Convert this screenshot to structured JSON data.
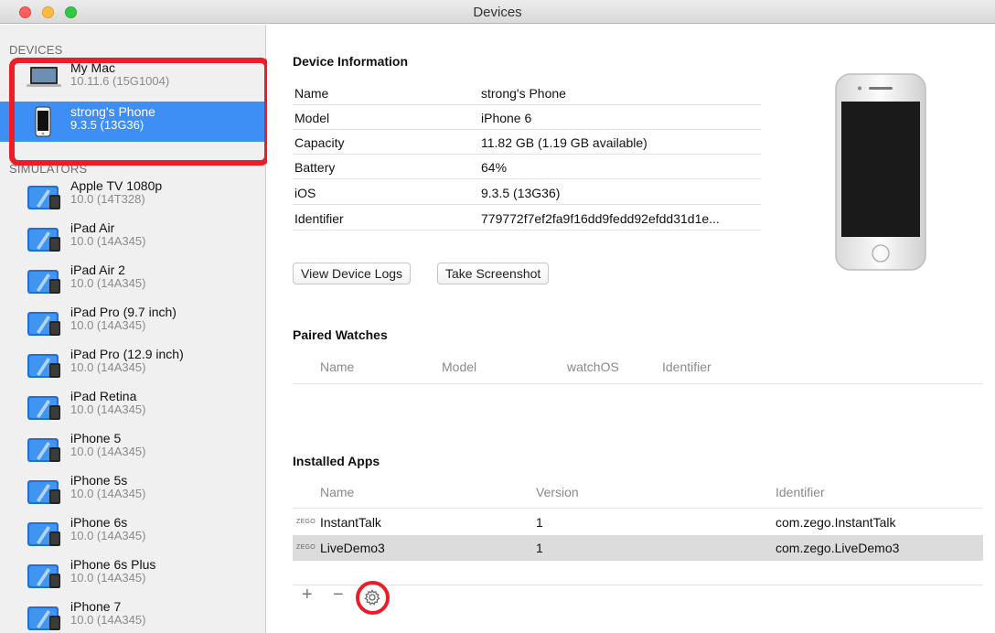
{
  "window": {
    "title": "Devices"
  },
  "sidebar": {
    "devices_header": "DEVICES",
    "simulators_header": "SIMULATORS",
    "devices": [
      {
        "name": "My Mac",
        "sub": "10.11.6 (15G1004)",
        "icon": "mac-icon"
      },
      {
        "name": "strong's Phone",
        "sub": "9.3.5 (13G36)",
        "icon": "iphone-icon"
      }
    ],
    "simulators": [
      {
        "name": "Apple TV 1080p",
        "sub": "10.0 (14T328)"
      },
      {
        "name": "iPad Air",
        "sub": "10.0 (14A345)"
      },
      {
        "name": "iPad Air 2",
        "sub": "10.0 (14A345)"
      },
      {
        "name": "iPad Pro (9.7 inch)",
        "sub": "10.0 (14A345)"
      },
      {
        "name": "iPad Pro (12.9 inch)",
        "sub": "10.0 (14A345)"
      },
      {
        "name": "iPad Retina",
        "sub": "10.0 (14A345)"
      },
      {
        "name": "iPhone 5",
        "sub": "10.0 (14A345)"
      },
      {
        "name": "iPhone 5s",
        "sub": "10.0 (14A345)"
      },
      {
        "name": "iPhone 6s",
        "sub": "10.0 (14A345)"
      },
      {
        "name": "iPhone 6s Plus",
        "sub": "10.0 (14A345)"
      },
      {
        "name": "iPhone 7",
        "sub": "10.0 (14A345)"
      }
    ]
  },
  "device_info": {
    "heading": "Device Information",
    "rows": [
      {
        "key": "Name",
        "value": "strong's Phone"
      },
      {
        "key": "Model",
        "value": "iPhone 6"
      },
      {
        "key": "Capacity",
        "value": "11.82 GB (1.19 GB available)"
      },
      {
        "key": "Battery",
        "value": "64%"
      },
      {
        "key": "iOS",
        "value": "9.3.5 (13G36)"
      },
      {
        "key": "Identifier",
        "value": "779772f7ef2fa9f16dd9fedd92efdd31d1e..."
      }
    ],
    "view_logs_label": "View Device Logs",
    "screenshot_label": "Take Screenshot"
  },
  "paired_watches": {
    "heading": "Paired Watches",
    "columns": [
      "Name",
      "Model",
      "watchOS",
      "Identifier"
    ]
  },
  "installed_apps": {
    "heading": "Installed Apps",
    "columns": [
      "Name",
      "Version",
      "Identifier"
    ],
    "rows": [
      {
        "badge": "ZEGO",
        "name": "InstantTalk",
        "version": "1",
        "identifier": "com.zego.InstantTalk"
      },
      {
        "badge": "ZEGO",
        "name": "LiveDemo3",
        "version": "1",
        "identifier": "com.zego.LiveDemo3"
      }
    ],
    "add_label": "+",
    "remove_label": "−",
    "gear_icon": "gear-icon"
  },
  "colors": {
    "selection": "#3d8ff5",
    "annotation": "#ea1d28"
  }
}
